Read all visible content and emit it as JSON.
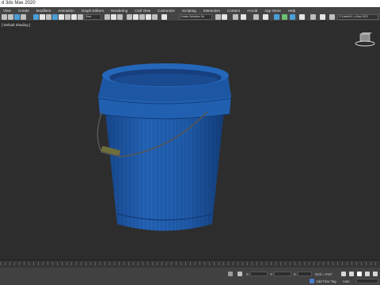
{
  "window": {
    "title": "d 3ds Max 2020"
  },
  "menu": {
    "items": [
      "View",
      "Create",
      "Modifiers",
      "Animation",
      "Graph Editors",
      "Rendering",
      "Civil View",
      "Customize",
      "Scripting",
      "Interactive",
      "Content",
      "Arnold",
      "App Store",
      "Help"
    ]
  },
  "toolbar": {
    "filter_value": "View",
    "selection_set_value": "Create Selection Se",
    "workspace_value": "C:\\Users\\N...s Max 2020"
  },
  "viewport": {
    "label": "[ Default Shading ]",
    "object_color": "#1f5aa8"
  },
  "status": {
    "x_label": "X:",
    "y_label": "Y:",
    "z_label": "Z:",
    "grid_text": "Grid = 0'10\"",
    "add_time_tag": "Add Time Tag",
    "auto_label": "Auto"
  },
  "colors": {
    "accent": "#4a9fd8",
    "background": "#2b2b2b",
    "bucket": "#1f5aa8",
    "handle": "#5a5a5a",
    "handle_grip": "#6e6e3c"
  }
}
